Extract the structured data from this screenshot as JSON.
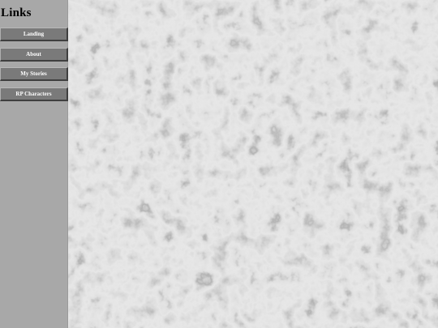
{
  "sidebar": {
    "title": "Links",
    "items": [
      {
        "label": "Landing"
      },
      {
        "label": "About"
      },
      {
        "label": "My Stories"
      },
      {
        "label": "RP Characters"
      }
    ]
  },
  "colors": {
    "sidebar_bg": "#a8a8a8",
    "button_bg": "#7a7a7a",
    "button_text": "#ffffff",
    "marble_base": "#b3b3b3",
    "marble_vein": "#6e6e6e"
  },
  "background": {
    "pattern": "grey-marble-texture"
  }
}
